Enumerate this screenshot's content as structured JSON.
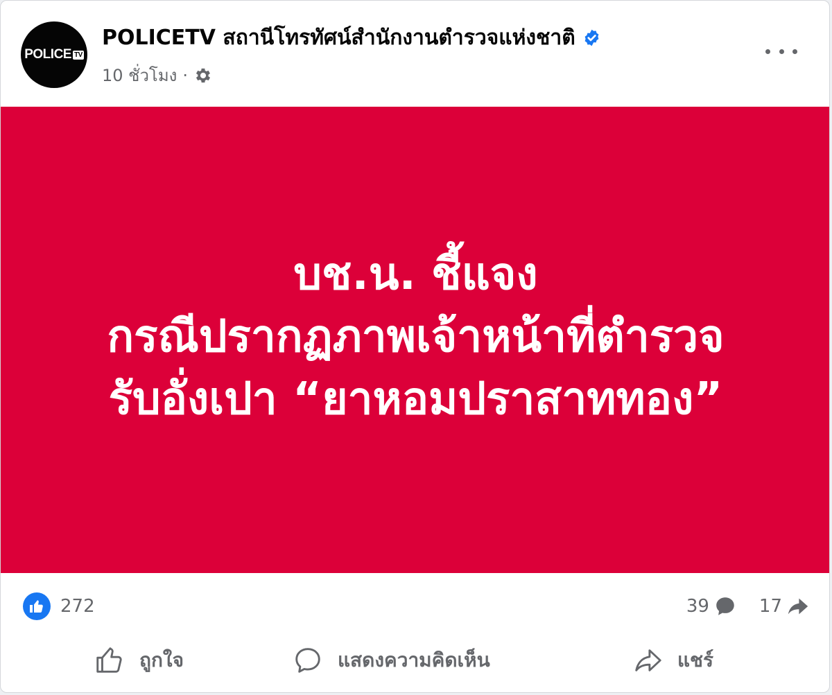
{
  "post": {
    "author": {
      "avatar_text": "POLICE",
      "avatar_tv": "TV",
      "name": "POLICETV สถานีโทรทัศน์สำนักงานตำรวจแห่งชาติ",
      "verified_icon": "verified-badge-icon"
    },
    "meta": {
      "time": "10 ชั่วโมง",
      "separator": "·",
      "audience_icon": "gear-icon"
    },
    "image": {
      "background": "#dc0039",
      "lines": [
        "บช.น. ชี้แจง",
        "กรณีปรากฏภาพเจ้าหน้าที่ตำรวจ",
        "รับอั่งเปา “ยาหอมปราสาททอง”"
      ]
    },
    "stats": {
      "reactions_count": "272",
      "comments_count": "39",
      "shares_count": "17"
    },
    "actions": {
      "like_label": "ถูกใจ",
      "comment_label": "แสดงความคิดเห็น",
      "share_label": "แชร์"
    }
  },
  "colors": {
    "accent_blue": "#1877f2",
    "secondary_text": "#65676b",
    "post_red": "#dc0039"
  }
}
